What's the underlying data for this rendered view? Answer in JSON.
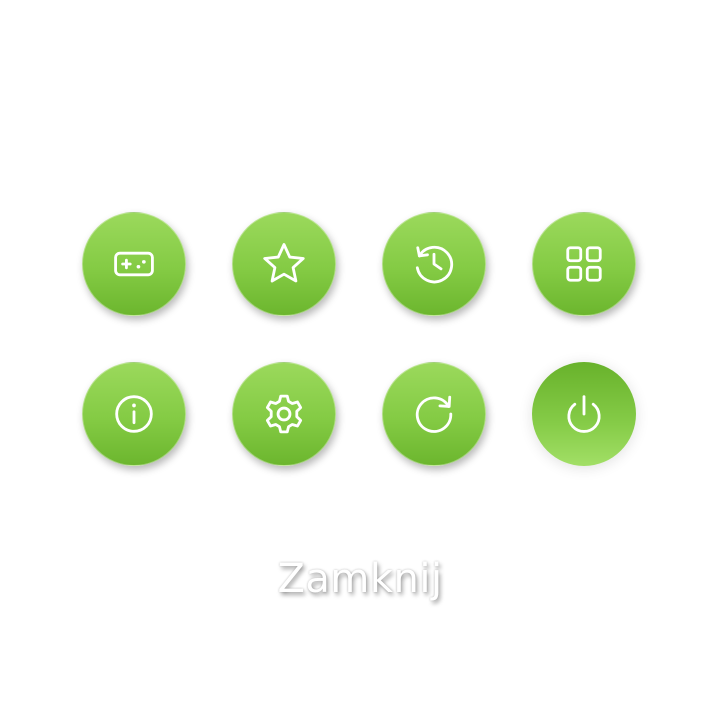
{
  "buttons": [
    {
      "icon": "gamepad-icon"
    },
    {
      "icon": "star-icon"
    },
    {
      "icon": "history-icon"
    },
    {
      "icon": "apps-grid-icon"
    },
    {
      "icon": "info-icon"
    },
    {
      "icon": "settings-gear-icon"
    },
    {
      "icon": "refresh-icon"
    },
    {
      "icon": "power-icon",
      "state": "pressed"
    }
  ],
  "caption": "Zamknij",
  "colors": {
    "button_light": "#9bd95c",
    "button_dark": "#6cb62e",
    "icon": "#ffffff",
    "caption": "#ffffff"
  }
}
